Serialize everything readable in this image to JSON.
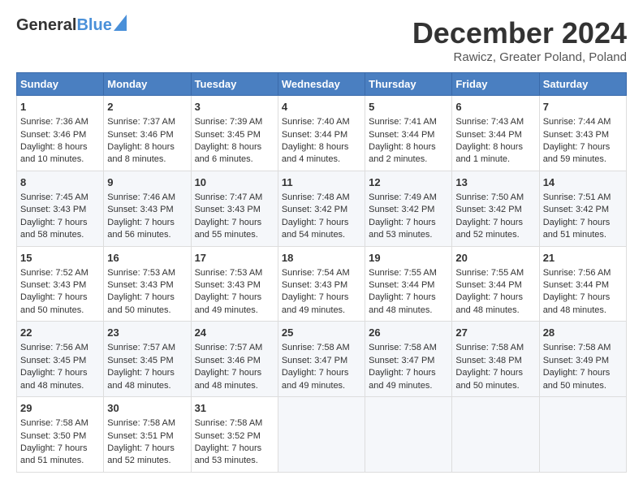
{
  "header": {
    "logo_general": "General",
    "logo_blue": "Blue",
    "title": "December 2024",
    "subtitle": "Rawicz, Greater Poland, Poland"
  },
  "calendar": {
    "days_of_week": [
      "Sunday",
      "Monday",
      "Tuesday",
      "Wednesday",
      "Thursday",
      "Friday",
      "Saturday"
    ],
    "weeks": [
      [
        {
          "day": "1",
          "sunrise": "Sunrise: 7:36 AM",
          "sunset": "Sunset: 3:46 PM",
          "daylight": "Daylight: 8 hours and 10 minutes."
        },
        {
          "day": "2",
          "sunrise": "Sunrise: 7:37 AM",
          "sunset": "Sunset: 3:46 PM",
          "daylight": "Daylight: 8 hours and 8 minutes."
        },
        {
          "day": "3",
          "sunrise": "Sunrise: 7:39 AM",
          "sunset": "Sunset: 3:45 PM",
          "daylight": "Daylight: 8 hours and 6 minutes."
        },
        {
          "day": "4",
          "sunrise": "Sunrise: 7:40 AM",
          "sunset": "Sunset: 3:44 PM",
          "daylight": "Daylight: 8 hours and 4 minutes."
        },
        {
          "day": "5",
          "sunrise": "Sunrise: 7:41 AM",
          "sunset": "Sunset: 3:44 PM",
          "daylight": "Daylight: 8 hours and 2 minutes."
        },
        {
          "day": "6",
          "sunrise": "Sunrise: 7:43 AM",
          "sunset": "Sunset: 3:44 PM",
          "daylight": "Daylight: 8 hours and 1 minute."
        },
        {
          "day": "7",
          "sunrise": "Sunrise: 7:44 AM",
          "sunset": "Sunset: 3:43 PM",
          "daylight": "Daylight: 7 hours and 59 minutes."
        }
      ],
      [
        {
          "day": "8",
          "sunrise": "Sunrise: 7:45 AM",
          "sunset": "Sunset: 3:43 PM",
          "daylight": "Daylight: 7 hours and 58 minutes."
        },
        {
          "day": "9",
          "sunrise": "Sunrise: 7:46 AM",
          "sunset": "Sunset: 3:43 PM",
          "daylight": "Daylight: 7 hours and 56 minutes."
        },
        {
          "day": "10",
          "sunrise": "Sunrise: 7:47 AM",
          "sunset": "Sunset: 3:43 PM",
          "daylight": "Daylight: 7 hours and 55 minutes."
        },
        {
          "day": "11",
          "sunrise": "Sunrise: 7:48 AM",
          "sunset": "Sunset: 3:42 PM",
          "daylight": "Daylight: 7 hours and 54 minutes."
        },
        {
          "day": "12",
          "sunrise": "Sunrise: 7:49 AM",
          "sunset": "Sunset: 3:42 PM",
          "daylight": "Daylight: 7 hours and 53 minutes."
        },
        {
          "day": "13",
          "sunrise": "Sunrise: 7:50 AM",
          "sunset": "Sunset: 3:42 PM",
          "daylight": "Daylight: 7 hours and 52 minutes."
        },
        {
          "day": "14",
          "sunrise": "Sunrise: 7:51 AM",
          "sunset": "Sunset: 3:42 PM",
          "daylight": "Daylight: 7 hours and 51 minutes."
        }
      ],
      [
        {
          "day": "15",
          "sunrise": "Sunrise: 7:52 AM",
          "sunset": "Sunset: 3:43 PM",
          "daylight": "Daylight: 7 hours and 50 minutes."
        },
        {
          "day": "16",
          "sunrise": "Sunrise: 7:53 AM",
          "sunset": "Sunset: 3:43 PM",
          "daylight": "Daylight: 7 hours and 50 minutes."
        },
        {
          "day": "17",
          "sunrise": "Sunrise: 7:53 AM",
          "sunset": "Sunset: 3:43 PM",
          "daylight": "Daylight: 7 hours and 49 minutes."
        },
        {
          "day": "18",
          "sunrise": "Sunrise: 7:54 AM",
          "sunset": "Sunset: 3:43 PM",
          "daylight": "Daylight: 7 hours and 49 minutes."
        },
        {
          "day": "19",
          "sunrise": "Sunrise: 7:55 AM",
          "sunset": "Sunset: 3:44 PM",
          "daylight": "Daylight: 7 hours and 48 minutes."
        },
        {
          "day": "20",
          "sunrise": "Sunrise: 7:55 AM",
          "sunset": "Sunset: 3:44 PM",
          "daylight": "Daylight: 7 hours and 48 minutes."
        },
        {
          "day": "21",
          "sunrise": "Sunrise: 7:56 AM",
          "sunset": "Sunset: 3:44 PM",
          "daylight": "Daylight: 7 hours and 48 minutes."
        }
      ],
      [
        {
          "day": "22",
          "sunrise": "Sunrise: 7:56 AM",
          "sunset": "Sunset: 3:45 PM",
          "daylight": "Daylight: 7 hours and 48 minutes."
        },
        {
          "day": "23",
          "sunrise": "Sunrise: 7:57 AM",
          "sunset": "Sunset: 3:45 PM",
          "daylight": "Daylight: 7 hours and 48 minutes."
        },
        {
          "day": "24",
          "sunrise": "Sunrise: 7:57 AM",
          "sunset": "Sunset: 3:46 PM",
          "daylight": "Daylight: 7 hours and 48 minutes."
        },
        {
          "day": "25",
          "sunrise": "Sunrise: 7:58 AM",
          "sunset": "Sunset: 3:47 PM",
          "daylight": "Daylight: 7 hours and 49 minutes."
        },
        {
          "day": "26",
          "sunrise": "Sunrise: 7:58 AM",
          "sunset": "Sunset: 3:47 PM",
          "daylight": "Daylight: 7 hours and 49 minutes."
        },
        {
          "day": "27",
          "sunrise": "Sunrise: 7:58 AM",
          "sunset": "Sunset: 3:48 PM",
          "daylight": "Daylight: 7 hours and 50 minutes."
        },
        {
          "day": "28",
          "sunrise": "Sunrise: 7:58 AM",
          "sunset": "Sunset: 3:49 PM",
          "daylight": "Daylight: 7 hours and 50 minutes."
        }
      ],
      [
        {
          "day": "29",
          "sunrise": "Sunrise: 7:58 AM",
          "sunset": "Sunset: 3:50 PM",
          "daylight": "Daylight: 7 hours and 51 minutes."
        },
        {
          "day": "30",
          "sunrise": "Sunrise: 7:58 AM",
          "sunset": "Sunset: 3:51 PM",
          "daylight": "Daylight: 7 hours and 52 minutes."
        },
        {
          "day": "31",
          "sunrise": "Sunrise: 7:58 AM",
          "sunset": "Sunset: 3:52 PM",
          "daylight": "Daylight: 7 hours and 53 minutes."
        },
        null,
        null,
        null,
        null
      ]
    ]
  }
}
